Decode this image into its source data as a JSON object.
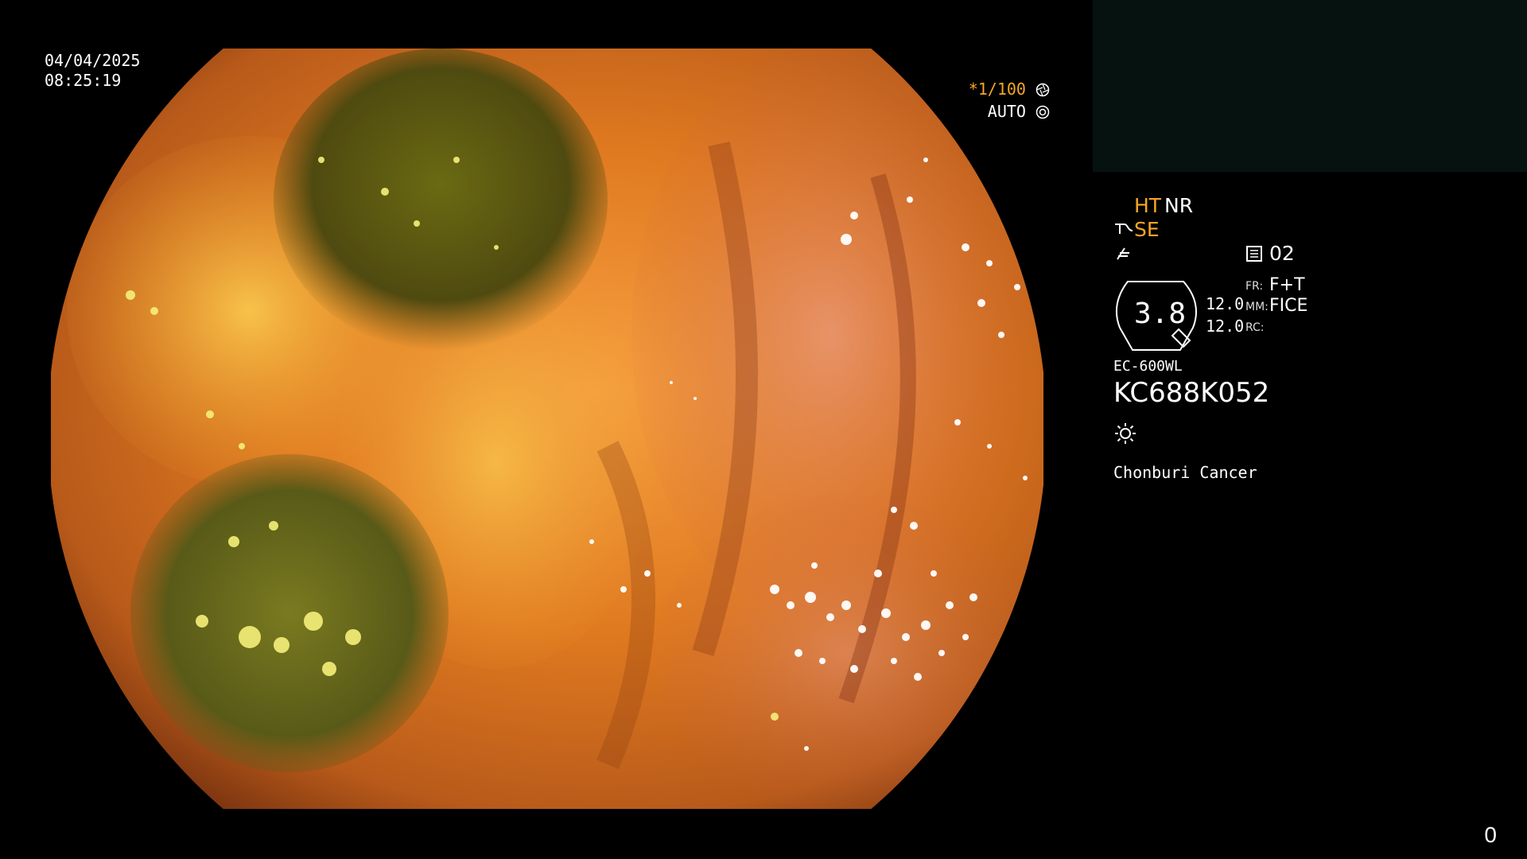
{
  "overlay": {
    "date": "04/04/2025",
    "time": "08:25:19",
    "shutter_value": "1/100",
    "shutter_mode": "AUTO",
    "counter": "0"
  },
  "panel": {
    "ht_label": "HT",
    "nr_label": "NR",
    "se_label": "SE",
    "channel": "02",
    "badge_value": "3.8",
    "val_top": "12.0",
    "val_bottom": "12.0",
    "fr_label": "FR:",
    "fr_value": "F+T",
    "mm_label": "MM:",
    "mm_value": "FICE",
    "rc_label": "RC:",
    "scope_model": "EC-600WL",
    "serial": "KC688K052",
    "institution": "Chonburi Cancer"
  },
  "icons": {
    "shutter_icon": "aperture-icon",
    "auto_icon": "iris-icon",
    "light_icon": "sun-icon"
  },
  "colors": {
    "accent": "#f5a623",
    "mucosa_base": "#d2691e",
    "fluid_green": "#5a5a12"
  }
}
